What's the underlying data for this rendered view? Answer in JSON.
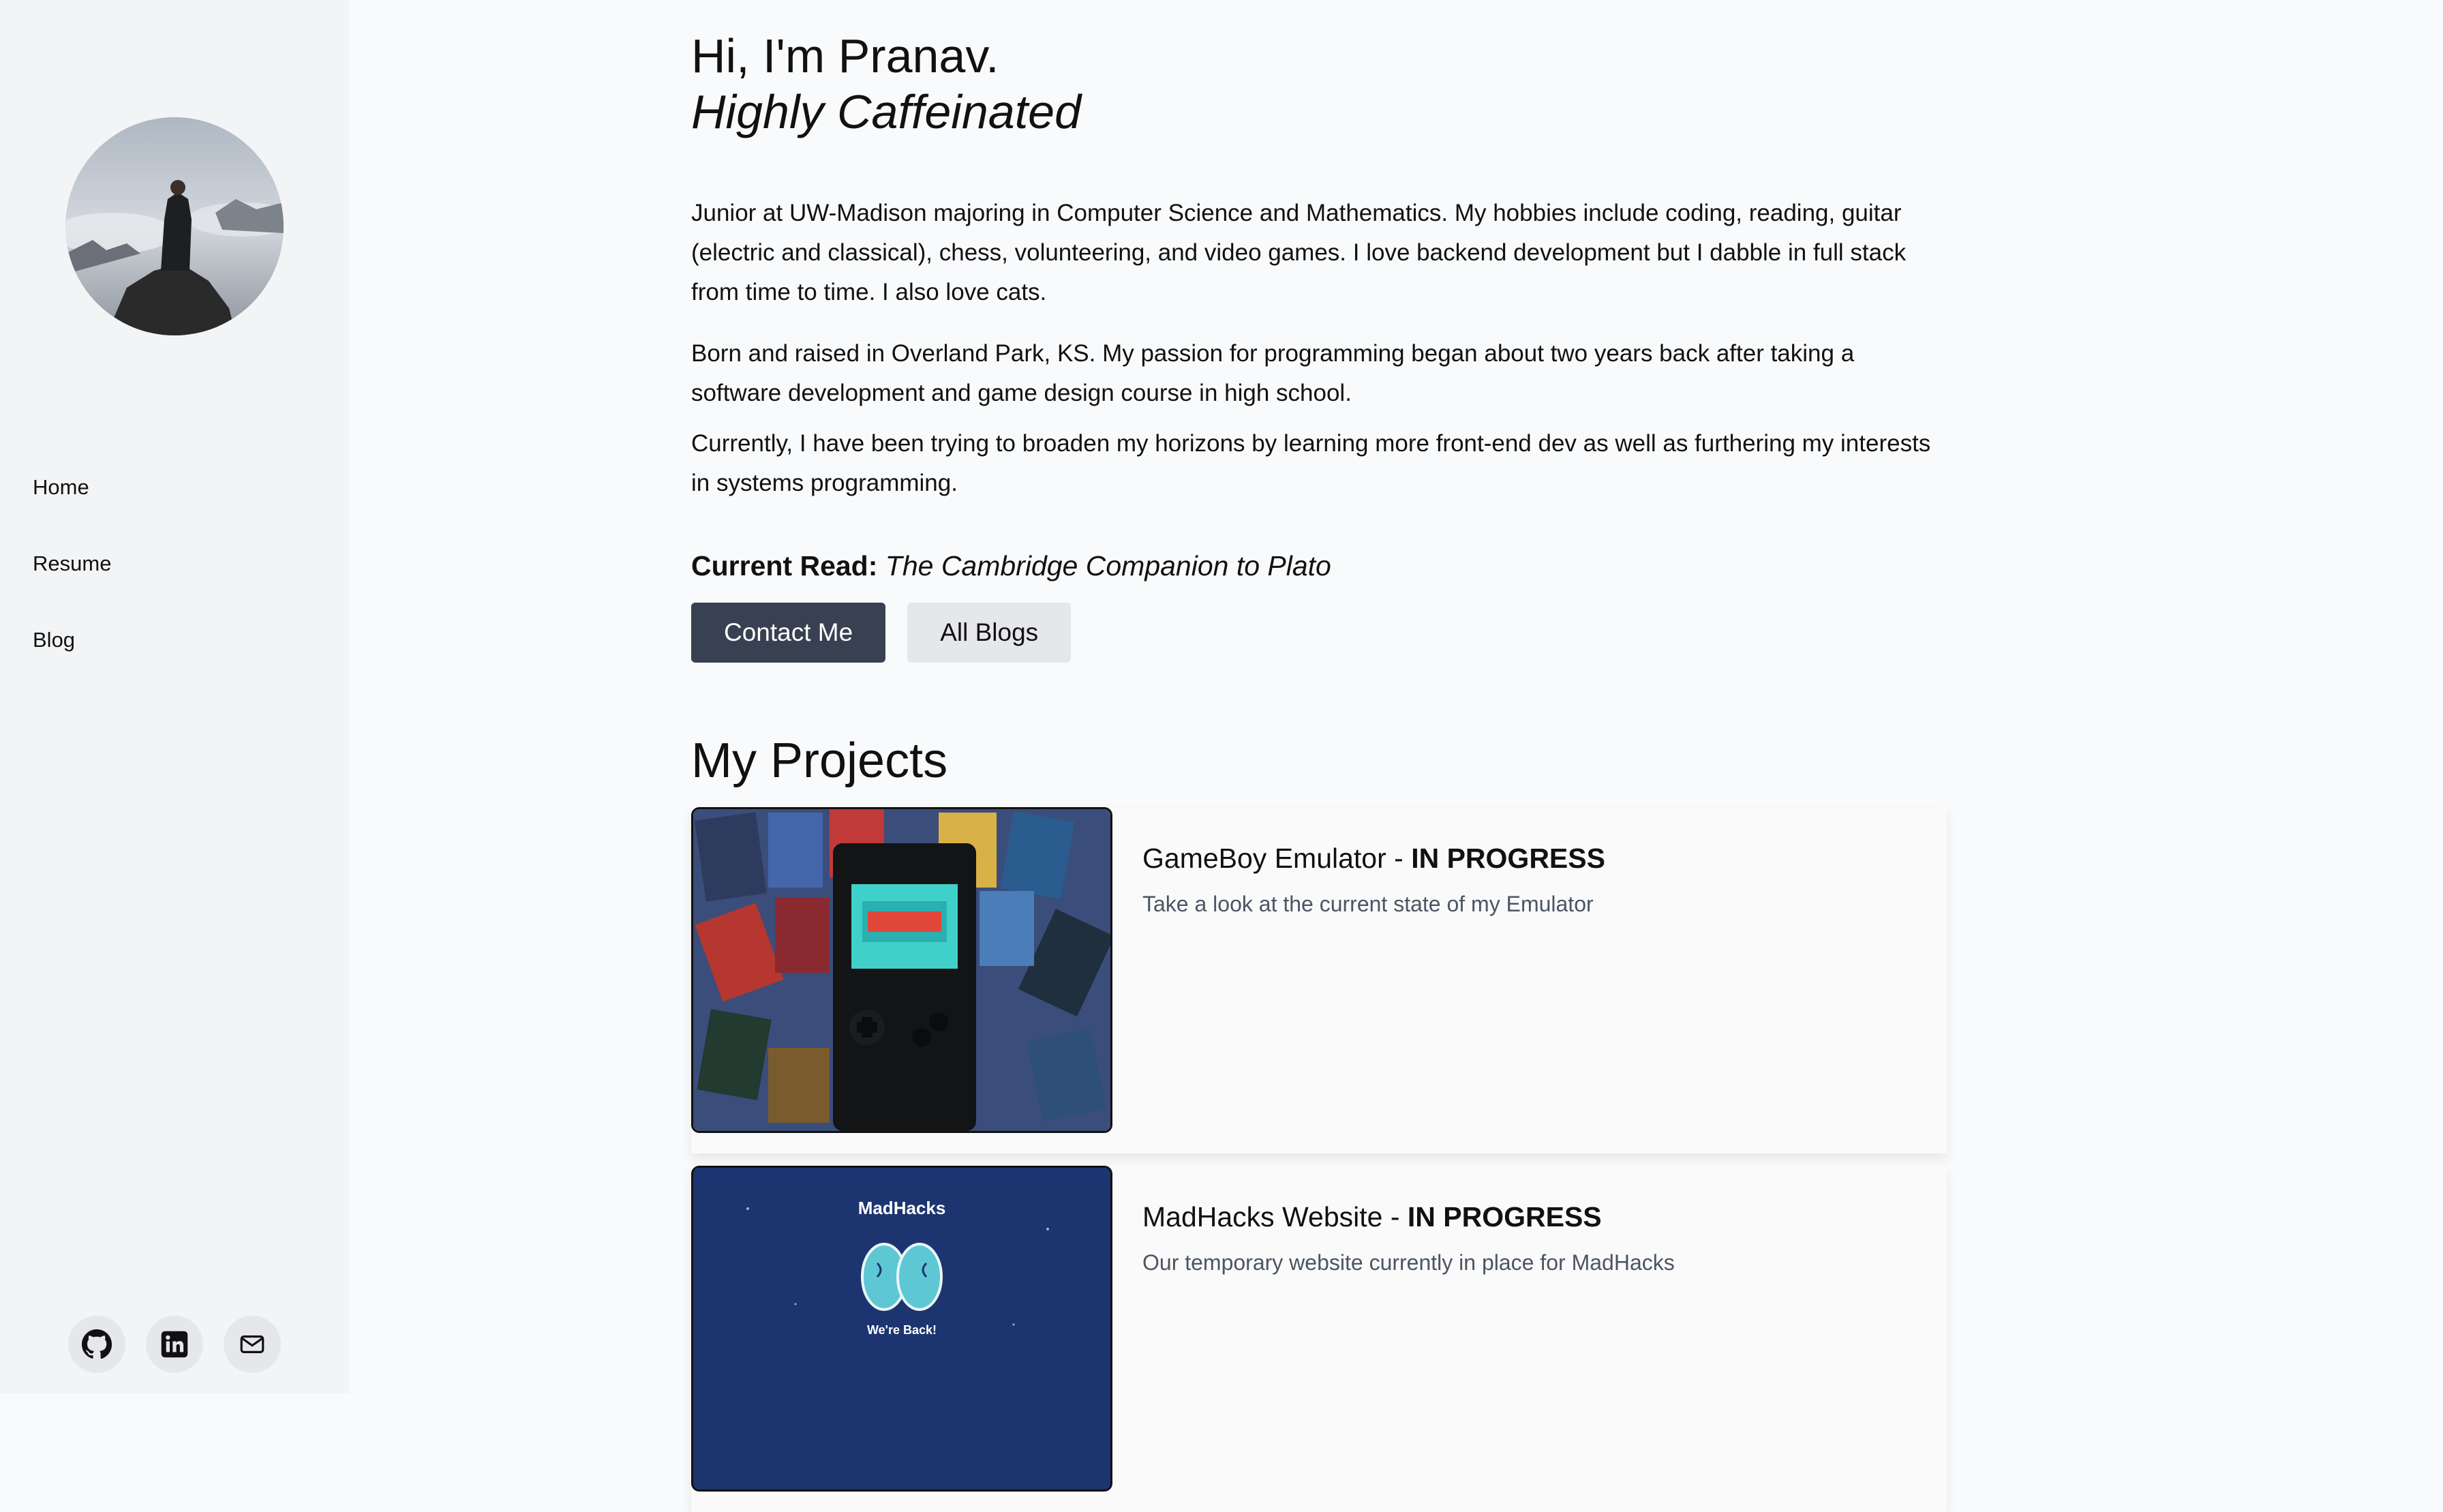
{
  "sidebar": {
    "nav": [
      {
        "label": "Home"
      },
      {
        "label": "Resume"
      },
      {
        "label": "Blog"
      }
    ],
    "socials": [
      {
        "icon": "github-icon"
      },
      {
        "icon": "linkedin-icon"
      },
      {
        "icon": "mail-icon"
      }
    ]
  },
  "hero": {
    "greeting": "Hi, I'm Pranav.",
    "tagline": "Highly Caffeinated",
    "paragraphs": [
      "Junior at UW-Madison majoring in Computer Science and Mathematics. My hobbies include coding, reading, guitar (electric and classical), chess, volunteering, and video games. I love backend development but I dabble in full stack from time to time. I also love cats.",
      "Born and raised in Overland Park, KS. My passion for programming began about two years back after taking a software development and game design course in high school.",
      "Currently, I have been trying to broaden my horizons by learning more front-end dev as well as furthering my interests in systems programming."
    ],
    "current_read_label": "Current Read:",
    "current_read_title": "The Cambridge Companion to Plato",
    "contact_button": "Contact Me",
    "blogs_button": "All Blogs"
  },
  "projects": {
    "title": "My Projects",
    "items": [
      {
        "name": "GameBoy Emulator - ",
        "status": "IN PROGRESS",
        "description": "Take a look at the current state of my Emulator"
      },
      {
        "name": "MadHacks Website - ",
        "status": "IN PROGRESS",
        "description": "Our temporary website currently in place for MadHacks",
        "image_heading": "MadHacks",
        "image_caption": "We're Back!"
      }
    ]
  }
}
